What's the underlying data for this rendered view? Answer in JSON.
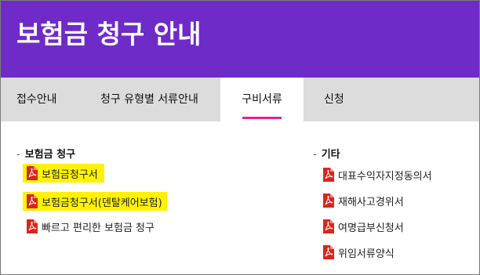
{
  "header": {
    "title": "보험금 청구 안내"
  },
  "tabs": [
    {
      "label": "접수안내"
    },
    {
      "label": "청구 유형별 서류안내"
    },
    {
      "label": "구비서류",
      "active": true
    },
    {
      "label": "신청"
    }
  ],
  "colors": {
    "header_bg": "#6f2bc7",
    "tab_underline": "#e8208a",
    "highlight": "#fff200",
    "pdf_icon": "#d9261c"
  },
  "left_section": {
    "title": "보험금 청구",
    "items": [
      {
        "label": "보험금청구서",
        "icon": "pdf-icon",
        "highlighted": true
      },
      {
        "label": "보험금청구서(덴탈케어보험)",
        "icon": "pdf-icon",
        "highlighted": true
      },
      {
        "label": "빠르고 편리한 보험금 청구",
        "icon": "pdf-icon",
        "highlighted": false
      }
    ]
  },
  "right_section": {
    "title": "기타",
    "items": [
      {
        "label": "대표수익자지정동의서",
        "icon": "pdf-icon"
      },
      {
        "label": "재해사고경위서",
        "icon": "pdf-icon"
      },
      {
        "label": "여명급부신청서",
        "icon": "pdf-icon"
      },
      {
        "label": "위임서류양식",
        "icon": "pdf-icon"
      }
    ]
  }
}
